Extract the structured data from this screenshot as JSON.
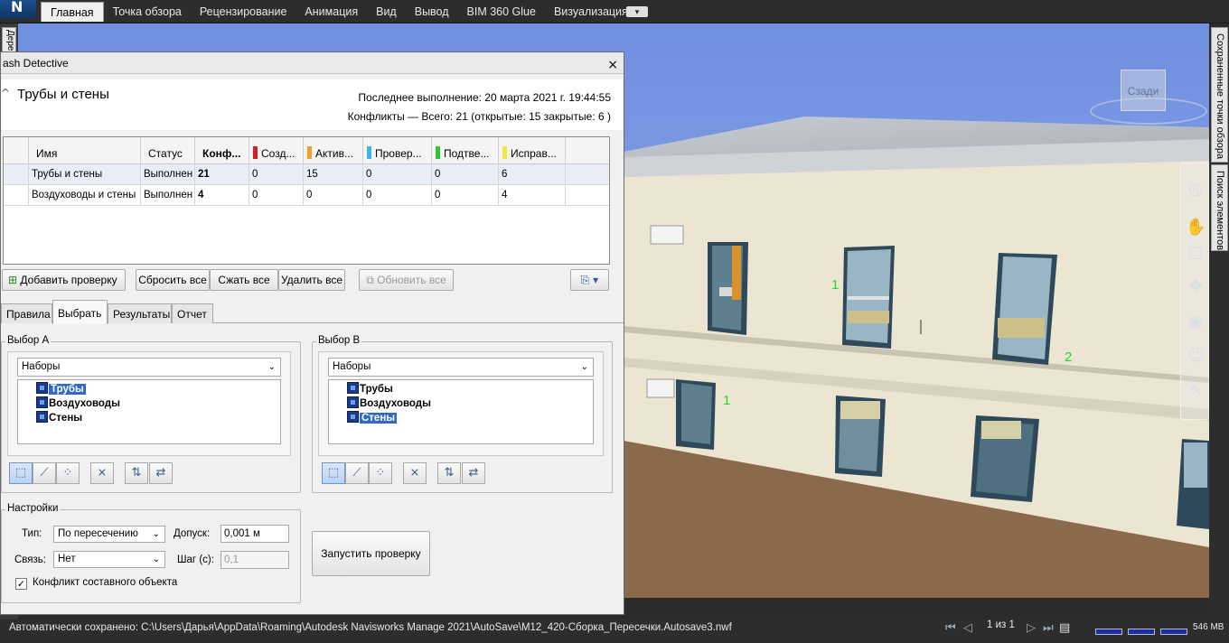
{
  "ribbon": {
    "app_letter": "N",
    "tabs": [
      "Главная",
      "Точка обзора",
      "Рецензирование",
      "Анимация",
      "Вид",
      "Вывод",
      "BIM 360 Glue",
      "Визуализация"
    ],
    "active_tab": "Главная",
    "qa_dropdown": "▾"
  },
  "left_strip": {
    "tab_label": "Дере"
  },
  "viewport": {
    "viewcube_label": "Сзади",
    "markers": [
      "1",
      "2",
      "1"
    ]
  },
  "right_panel": {
    "tabs": [
      "Сохраненные точки обзора",
      "Поиск элементов"
    ]
  },
  "clash": {
    "window_title": "ash Detective",
    "close": "×",
    "test_name": "Трубы и стены",
    "last_run": "Последнее выполнение:  20 марта 2021 г. 19:44:55",
    "conflicts_summary": "Конфликты —  Всего:  21  (открытые:  15  закрытые:  6 )",
    "columns": [
      {
        "label": "Имя",
        "color": ""
      },
      {
        "label": "Статус",
        "color": ""
      },
      {
        "label": "Конф...",
        "color": ""
      },
      {
        "label": "Созд...",
        "color": "#d31f1f"
      },
      {
        "label": "Актив...",
        "color": "#f0a030"
      },
      {
        "label": "Провер...",
        "color": "#3fb4e6"
      },
      {
        "label": "Подтве...",
        "color": "#2ec82e"
      },
      {
        "label": "Исправ...",
        "color": "#f2e640"
      }
    ],
    "rows": [
      {
        "name": "Трубы и стены",
        "status": "Выполнен",
        "conflicts": "21",
        "new": "0",
        "active": "15",
        "reviewed": "0",
        "approved": "0",
        "resolved": "6"
      },
      {
        "name": "Воздуховоды и стены",
        "status": "Выполнен",
        "conflicts": "4",
        "new": "0",
        "active": "0",
        "reviewed": "0",
        "approved": "0",
        "resolved": "4"
      }
    ],
    "buttons": {
      "add_test": "Добавить проверку",
      "reset_all": "Сбросить все",
      "compact_all": "Сжать все",
      "delete_all": "Удалить все",
      "update_all": "Обновить все"
    },
    "tabs": [
      "Правила",
      "Выбрать",
      "Результаты",
      "Отчет"
    ],
    "active_tab": "Выбрать",
    "selection_a": {
      "label": "Выбор A",
      "dropdown": "Наборы",
      "items": [
        "Трубы",
        "Воздуховоды",
        "Стены"
      ],
      "selected": "Трубы"
    },
    "selection_b": {
      "label": "Выбор B",
      "dropdown": "Наборы",
      "items": [
        "Трубы",
        "Воздуховоды",
        "Стены"
      ],
      "selected": "Стены"
    },
    "settings": {
      "label": "Настройки",
      "type_label": "Тип:",
      "type_value": "По пересечению",
      "tolerance_label": "Допуск:",
      "tolerance_value": "0,001 м",
      "link_label": "Связь:",
      "link_value": "Нет",
      "step_label": "Шаг (с):",
      "step_value": "0,1",
      "composite_label": "Конфликт составного объекта",
      "composite_checked": "✓"
    },
    "run_button": "Запустить проверку"
  },
  "statusbar": {
    "autosave": "Автоматически сохранено: C:\\Users\\Дарья\\AppData\\Roaming\\Autodesk Navisworks Manage 2021\\AutoSave\\M12_420-Сборка_Пересечки.Autosave3.nwf",
    "page": "1 из 1",
    "memory": "546 MB"
  }
}
